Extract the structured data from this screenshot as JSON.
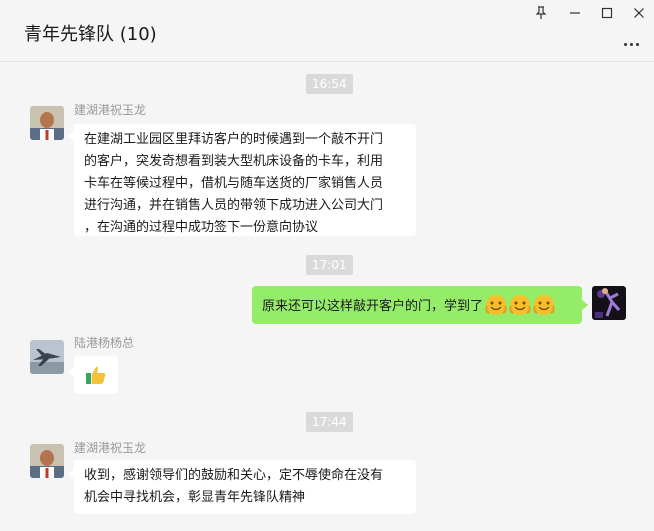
{
  "window": {
    "title": "青年先锋队 (10)"
  },
  "messages": {
    "m1": {
      "time": "16:54",
      "sender": "建湖港祝玉龙",
      "lines": [
        "在建湖工业园区里拜访客户的时候遇到一个敲不开门",
        "的客户，突发奇想看到装大型机床设备的卡车，利用",
        "卡车在等候过程中，借机与随车送货的厂家销售人员",
        "进行沟通，并在销售人员的带领下成功进入公司大门",
        "，在沟通的过程中成功签下一份意向协议"
      ]
    },
    "m2": {
      "time": "17:01",
      "text": "原来还可以这样敲开客户的门，学到了",
      "emoji_count": 3
    },
    "m3": {
      "sender": "陆港杨杨总",
      "icon": "thumbs-up-icon"
    },
    "m4": {
      "time": "17:44",
      "sender": "建湖港祝玉龙",
      "lines": [
        "收到，感谢领导们的鼓励和关心，定不辱使命在没有",
        "机会中寻找机会，彰显青年先锋队精神"
      ]
    }
  },
  "colors": {
    "background": "#f5f5f5",
    "bubble_other": "#ffffff",
    "bubble_self": "#95ec69",
    "time_badge": "#dadada"
  }
}
